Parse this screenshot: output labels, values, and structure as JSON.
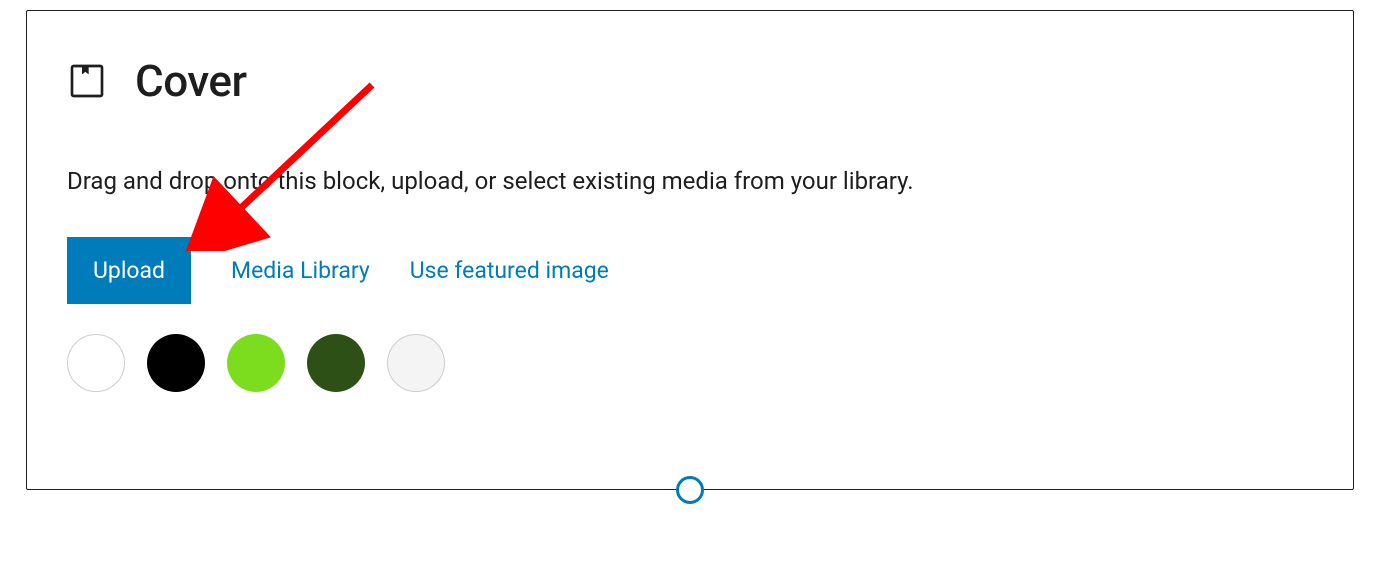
{
  "block": {
    "title": "Cover",
    "description": "Drag and drop onto this block, upload, or select existing media from your library."
  },
  "actions": {
    "upload": "Upload",
    "media_library": "Media Library",
    "use_featured": "Use featured image"
  },
  "swatches": [
    {
      "color": "#ffffff",
      "outlined": true
    },
    {
      "color": "#000000",
      "outlined": false
    },
    {
      "color": "#7bdd1e",
      "outlined": false
    },
    {
      "color": "#2d5016",
      "outlined": false
    },
    {
      "color": "#f4f4f4",
      "outlined": true
    }
  ],
  "annotation": {
    "arrow_color": "#ff0000"
  }
}
